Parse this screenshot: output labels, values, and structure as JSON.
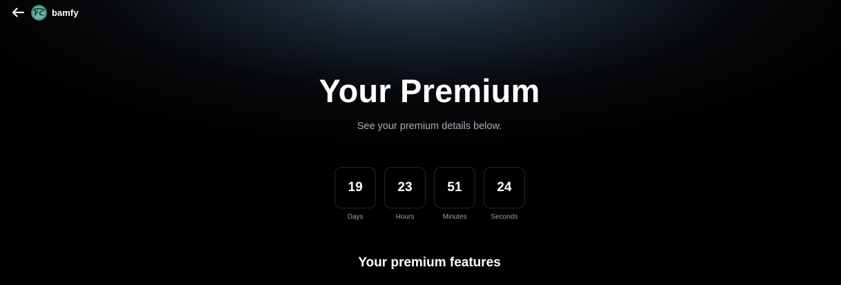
{
  "header": {
    "username": "bamfy",
    "back_icon": "arrow-left-icon",
    "avatar_icon": "profile-avatar"
  },
  "hero": {
    "title": "Your Premium",
    "subtitle": "See your premium details below."
  },
  "countdown": [
    {
      "value": "19",
      "label": "Days"
    },
    {
      "value": "23",
      "label": "Hours"
    },
    {
      "value": "51",
      "label": "Minutes"
    },
    {
      "value": "24",
      "label": "Seconds"
    }
  ],
  "features": {
    "title": "Your premium features"
  },
  "colors": {
    "background": "#000000",
    "glow": "#34485c",
    "subtitle": "#a9aeb5",
    "box_border": "#23272d"
  }
}
